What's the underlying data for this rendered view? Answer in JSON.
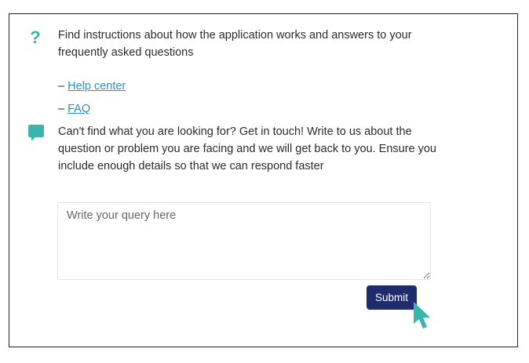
{
  "help": {
    "icon": "question-icon",
    "text": "Find instructions about how the application works and answers to your frequently asked questions",
    "links": [
      {
        "prefix": "– ",
        "label": "Help center"
      },
      {
        "prefix": "– ",
        "label": "FAQ"
      }
    ]
  },
  "contact": {
    "icon": "chat-bubble-icon",
    "text": "Can't find what you are looking for? Get in touch! Write to us about the question or problem you are facing and we will get back to you. Ensure you include enough details so that we can respond faster"
  },
  "form": {
    "query_placeholder": "Write your query here",
    "query_value": "",
    "submit_label": "Submit"
  },
  "colors": {
    "accent": "#3bb4b0",
    "link": "#2a8fc0",
    "button": "#1f2b6a"
  }
}
